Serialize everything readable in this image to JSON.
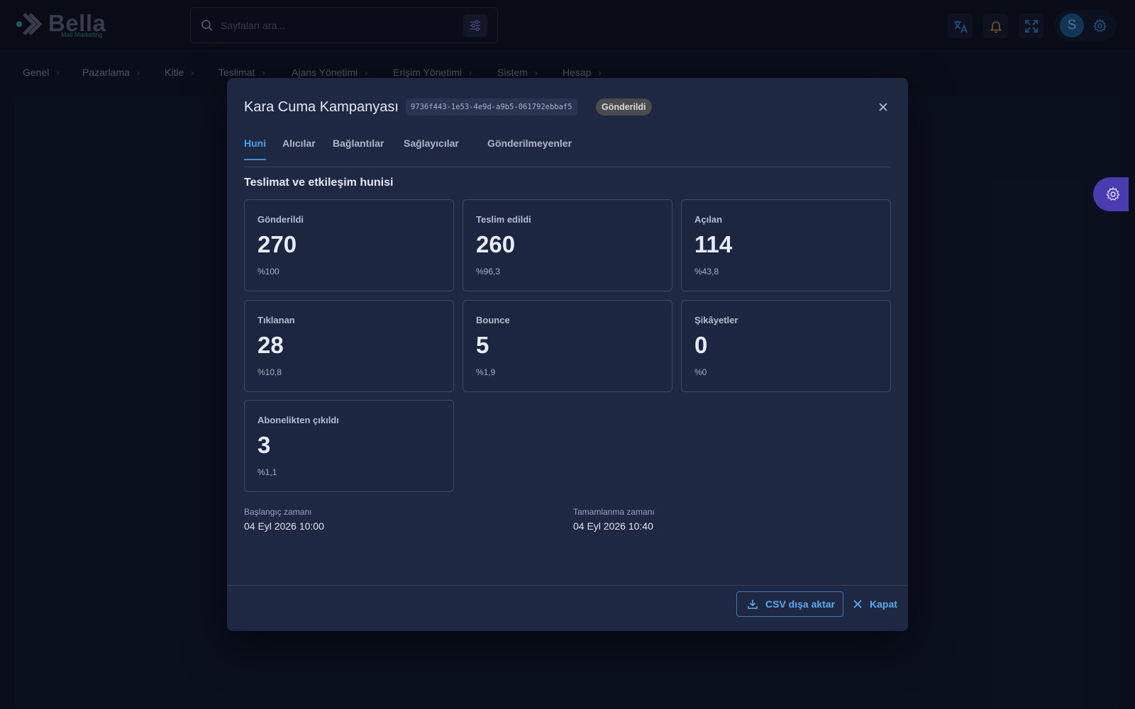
{
  "header": {
    "logo_text": "Bella",
    "logo_subtitle": "Mail Marketing",
    "search_placeholder": "Sayfaları ara...",
    "avatar_initial": "S"
  },
  "nav": {
    "items": [
      "Genel",
      "Pazarlama",
      "Kitle",
      "Teslimat",
      "Ajans Yönetimi",
      "Erişim Yönetimi",
      "Sistem",
      "Hesap"
    ]
  },
  "modal": {
    "title": "Kara Cuma Kampanyası",
    "campaign_id": "9736f443-1e53-4e9d-a9b5-061792ebbaf5",
    "status": "Gönderildi",
    "tabs": [
      "Huni",
      "Alıcılar",
      "Bağlantılar",
      "Sağlayıcılar",
      "Gönderilmeyenler"
    ],
    "active_tab": "Huni",
    "section_title": "Teslimat ve etkileşim hunisi",
    "metrics": [
      {
        "label": "Gönderildi",
        "value": "270",
        "pct": "%100"
      },
      {
        "label": "Teslim edildi",
        "value": "260",
        "pct": "%96,3"
      },
      {
        "label": "Açılan",
        "value": "114",
        "pct": "%43,8"
      },
      {
        "label": "Tıklanan",
        "value": "28",
        "pct": "%10,8"
      },
      {
        "label": "Bounce",
        "value": "5",
        "pct": "%1,9"
      },
      {
        "label": "Şikâyetler",
        "value": "0",
        "pct": "%0"
      },
      {
        "label": "Abonelikten çıkıldı",
        "value": "3",
        "pct": "%1,1"
      }
    ],
    "start_label": "Başlangıç zamanı",
    "start_value": "04 Eyl 2026 10:00",
    "end_label": "Tamamlanma zamanı",
    "end_value": "04 Eyl 2026 10:40",
    "csv_button": "CSV dışa aktar",
    "close_button": "Kapat"
  },
  "colors": {
    "accent": "#4aa3e8",
    "status_badge_bg": "#4a4b4f",
    "fab": "#4b3bb0"
  }
}
